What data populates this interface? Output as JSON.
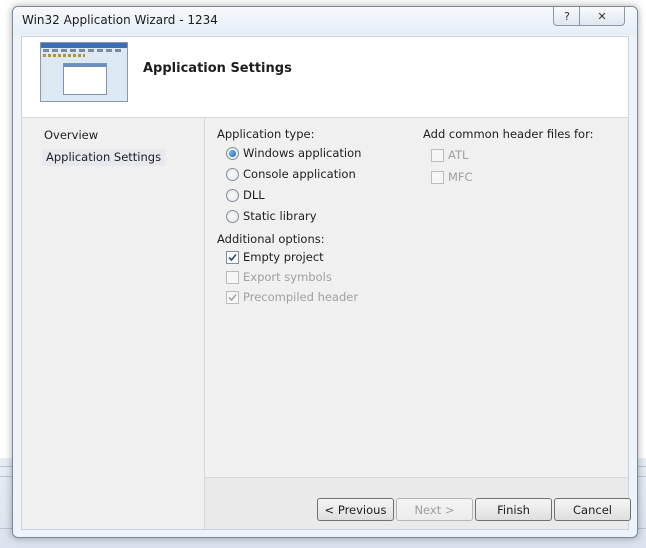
{
  "window": {
    "title": "Win32 Application Wizard - 1234",
    "help_glyph": "?",
    "close_glyph": "✕"
  },
  "header": {
    "title": "Application Settings"
  },
  "nav": {
    "items": [
      "Overview",
      "Application Settings"
    ]
  },
  "application_type": {
    "label": "Application type:",
    "options": [
      "Windows application",
      "Console application",
      "DLL",
      "Static library"
    ],
    "selected": "Windows application"
  },
  "additional_options": {
    "label": "Additional options:",
    "options": [
      {
        "label": "Empty project",
        "checked": true,
        "enabled": true
      },
      {
        "label": "Export symbols",
        "checked": false,
        "enabled": false
      },
      {
        "label": "Precompiled header",
        "checked": true,
        "enabled": false
      }
    ]
  },
  "common_headers": {
    "label": "Add common header files for:",
    "options": [
      {
        "label": "ATL",
        "checked": false,
        "enabled": false
      },
      {
        "label": "MFC",
        "checked": false,
        "enabled": false
      }
    ]
  },
  "buttons": {
    "previous": "< Previous",
    "next": "Next >",
    "finish": "Finish",
    "cancel": "Cancel"
  }
}
